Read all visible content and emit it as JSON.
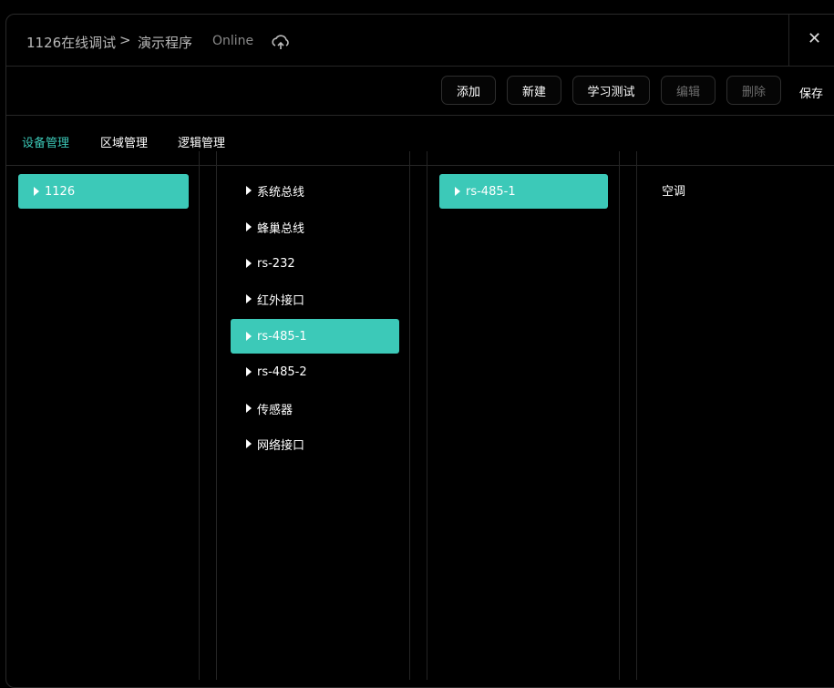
{
  "header": {
    "breadcrumb_root": "1126在线调试",
    "breadcrumb_sep": ">",
    "breadcrumb_page": "演示程序",
    "status": "Online",
    "cloud_icon": "cloud-sync-icon",
    "close_label": "✕"
  },
  "toolbar": {
    "add": "添加",
    "new": "新建",
    "learn_test": "学习测试",
    "edit": "编辑",
    "delete": "删除",
    "save": "保存"
  },
  "tabs": {
    "device": "设备管理",
    "area": "区域管理",
    "logic": "逻辑管理"
  },
  "columns": {
    "col1": [
      "1126"
    ],
    "col2": [
      "系统总线",
      "蜂巢总线",
      "rs-232",
      "红外接口",
      "rs-485-1",
      "rs-485-2",
      "传感器",
      "网络接口"
    ],
    "col3": [
      "rs-485-1"
    ],
    "col4": [
      "空调"
    ]
  },
  "colors": {
    "accent": "#3cc9b8",
    "background": "#000000"
  }
}
